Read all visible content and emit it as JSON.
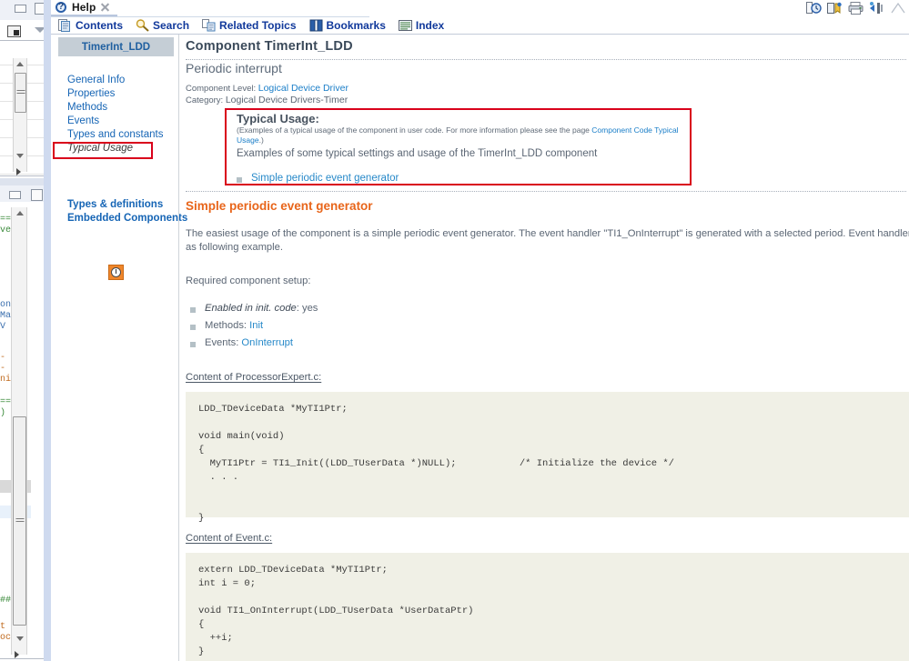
{
  "window": {
    "tab_label": "Help",
    "tab_icon": "help-icon",
    "close_icon": "close-icon"
  },
  "toolbar_right": [
    {
      "name": "show-in-table-of-contents-icon",
      "title": "Show in Table of Contents"
    },
    {
      "name": "bookmark-document-icon",
      "title": "Bookmark Document"
    },
    {
      "name": "print-page-icon",
      "title": "Print Page"
    },
    {
      "name": "synchronize-icon",
      "title": "Synchronize"
    },
    {
      "name": "minimize-icon",
      "title": "Minimize"
    }
  ],
  "navbar": [
    {
      "label": "Contents",
      "icon": "contents-icon"
    },
    {
      "label": "Search",
      "icon": "search-icon"
    },
    {
      "label": "Related Topics",
      "icon": "related-topics-icon"
    },
    {
      "label": "Bookmarks",
      "icon": "bookmarks-icon"
    },
    {
      "label": "Index",
      "icon": "index-icon"
    }
  ],
  "sidebar": {
    "title": "TimerInt_LDD",
    "links": [
      {
        "label": "General Info",
        "selected": false
      },
      {
        "label": "Properties",
        "selected": false
      },
      {
        "label": "Methods",
        "selected": false
      },
      {
        "label": "Events",
        "selected": false
      },
      {
        "label": "Types and constants",
        "selected": false
      },
      {
        "label": "Typical Usage",
        "selected": true
      }
    ],
    "links2": [
      {
        "label": "Types & definitions"
      },
      {
        "label": "Embedded Components"
      }
    ],
    "component_icon": "timer-component-icon"
  },
  "document": {
    "heading": "Component TimerInt_LDD",
    "subheading": "Periodic interrupt",
    "meta": {
      "level_label": "Component Level:",
      "level_value": "Logical Device Driver",
      "category_label": "Category:",
      "category_value": "Logical Device Drivers-Timer"
    },
    "typical_usage": {
      "title": "Typical Usage:",
      "note_prefix": "(Examples of a typical usage of the component in user code. For more information please see the page ",
      "note_link": "Component Code Typical Usage",
      "note_suffix": ".)",
      "paragraph": "Examples of some typical settings and usage of the TimerInt_LDD component",
      "link_item": "Simple periodic event generator"
    },
    "section": {
      "title": "Simple periodic event generator",
      "paragraph": "The easiest usage of the component is a simple periodic event generator. The event handler \"TI1_OnInterrupt\" is generated with a selected period. Event handler executes as following example.",
      "setup_label": "Required component setup:",
      "setup_items": [
        {
          "name": "Enabled in init. code",
          "sep": ": ",
          "value": "yes",
          "italic_name": true,
          "link": false
        },
        {
          "name": "Methods",
          "sep": ": ",
          "value": "Init",
          "italic_name": false,
          "link": true
        },
        {
          "name": "Events",
          "sep": ": ",
          "value": "OnInterrupt",
          "italic_name": false,
          "link": true
        }
      ],
      "code_blocks": [
        {
          "file_label": "Content of ProcessorExpert.c:",
          "code": "LDD_TDeviceData *MyTI1Ptr;\n\nvoid main(void)\n{\n  MyTI1Ptr = TI1_Init((LDD_TUserData *)NULL);           /* Initialize the device */\n  . . .\n\n\n}"
        },
        {
          "file_label": "Content of Event.c:",
          "code": "extern LDD_TDeviceData *MyTI1Ptr;\nint i = 0;\n\nvoid TI1_OnInterrupt(LDD_TUserData *UserDataPtr)\n{\n  ++i;\n}"
        }
      ]
    }
  },
  "highlights": {
    "color": "#d9001b",
    "regions": [
      "sidebar-typical-usage",
      "typical-usage-section"
    ]
  },
  "background_editor": {
    "code_fragments": [
      "===\nver",
      "one\nMas\nV :",
      "- c\n- l\nnit",
      "===\n)",
      "###",
      "t :\noco"
    ]
  }
}
